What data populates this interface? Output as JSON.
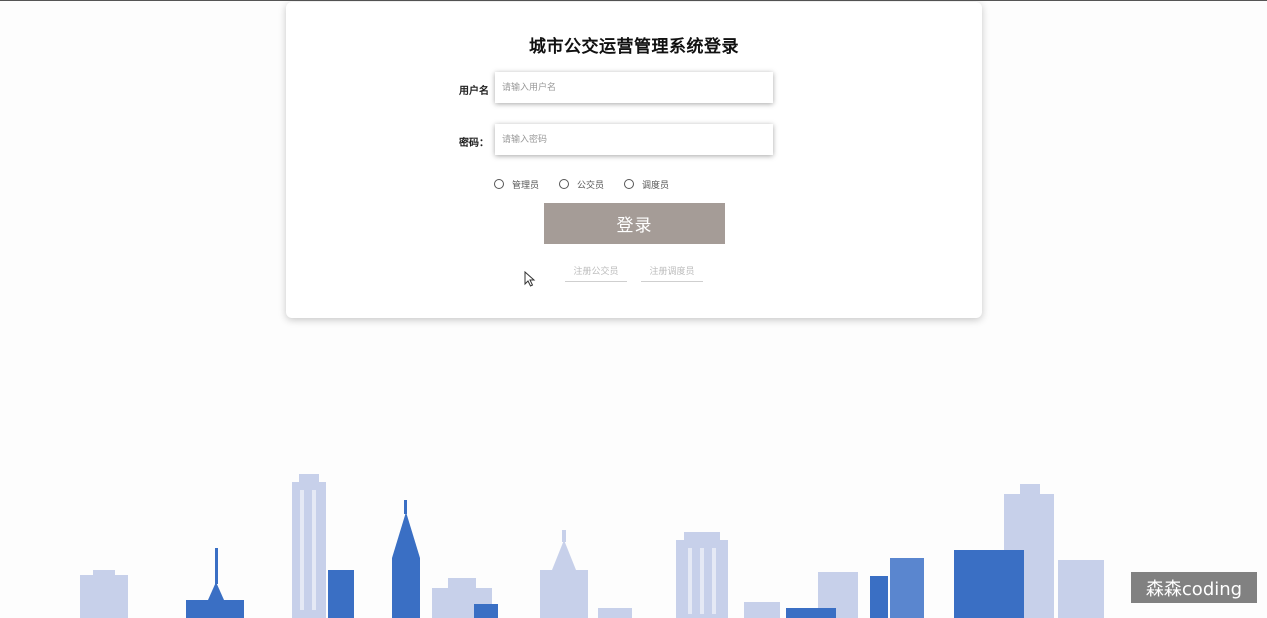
{
  "login": {
    "title": "城市公交运营管理系统登录",
    "username_label": "用户名",
    "username_placeholder": "请输入用户名",
    "password_label": "密码：",
    "password_placeholder": "请输入密码",
    "roles": [
      "管理员",
      "公交员",
      "调度员"
    ],
    "login_button": "登录",
    "links": [
      "注册公交员",
      "注册调度员"
    ]
  },
  "colors": {
    "login_button_bg": "#a59c97",
    "skyline_blue": "#3a6fc4",
    "skyline_light": "#c5cfe8"
  },
  "icons": {
    "cursor": "mouse-pointer-icon"
  },
  "watermark": "森森coding"
}
